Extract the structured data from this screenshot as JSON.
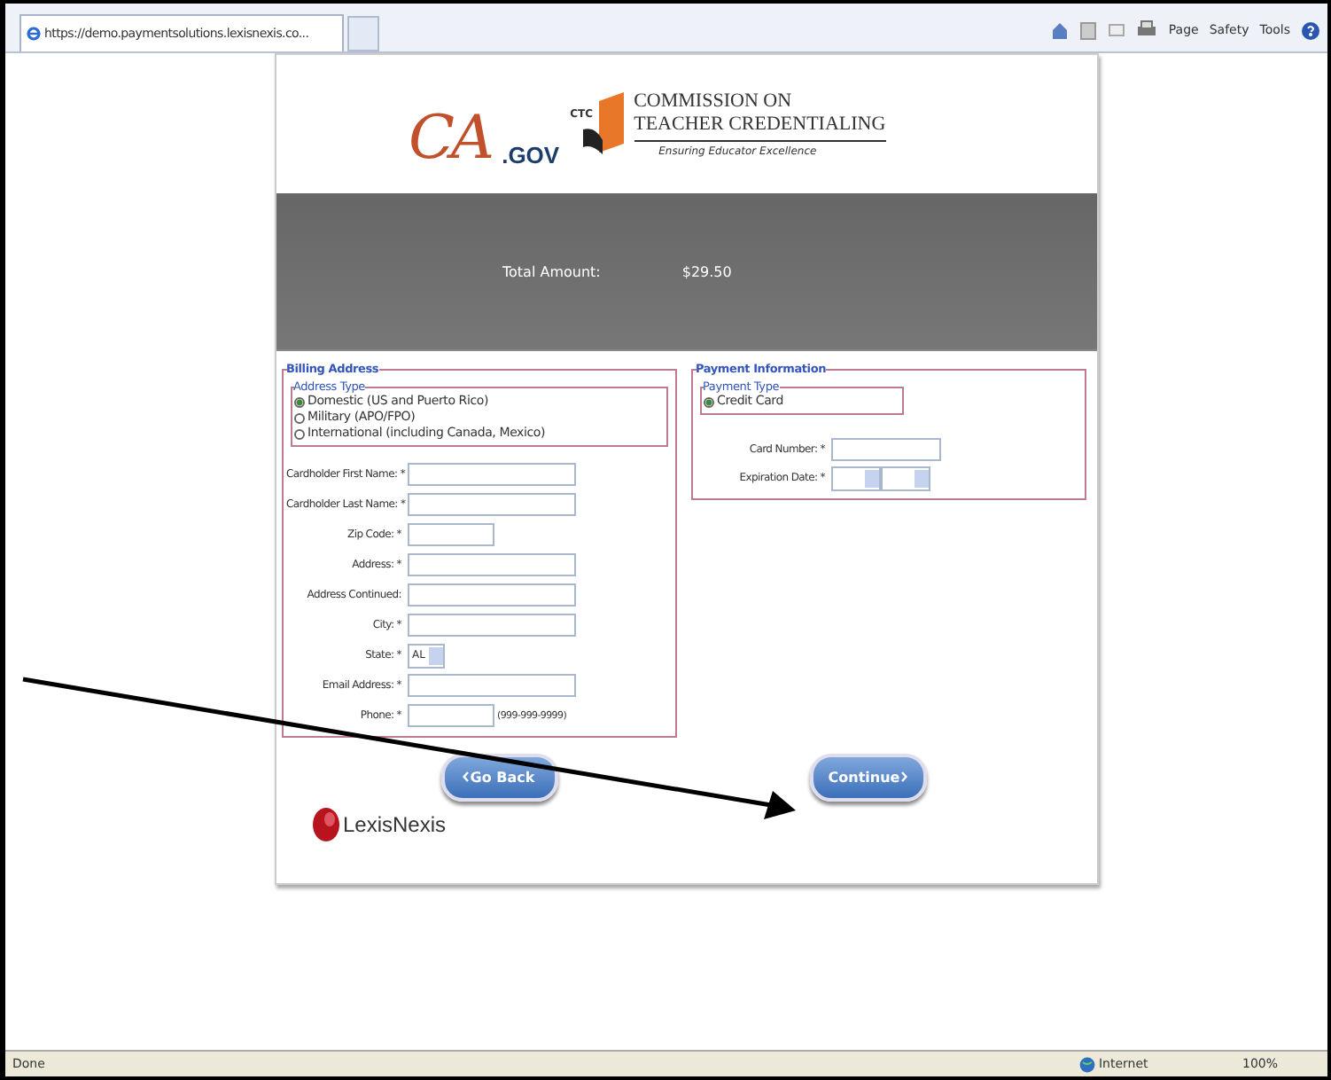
{
  "browser": {
    "tab_title": "https://demo.paymentsolutions.lexisnexis.co...",
    "toolbar": [
      "Page",
      "Safety",
      "Tools"
    ]
  },
  "header": {
    "ca_logo": "CA",
    "gov": ".GOV",
    "ctc": "CTC",
    "org_line1": "COMMISSION ON",
    "org_line2": "TEACHER CREDENTIALING",
    "tagline": "Ensuring Educator Excellence"
  },
  "total": {
    "label": "Total Amount:",
    "value": "$29.50"
  },
  "billing": {
    "legend": "Billing Address",
    "address_type": {
      "legend": "Address Type",
      "options": [
        {
          "label": "Domestic (US and Puerto Rico)",
          "selected": true
        },
        {
          "label": "Military (APO/FPO)",
          "selected": false
        },
        {
          "label": "International (including Canada, Mexico)",
          "selected": false
        }
      ]
    },
    "fields": [
      {
        "kind": "text",
        "label": "Cardholder First Name: *"
      },
      {
        "kind": "text",
        "label": "Cardholder Last Name: *"
      },
      {
        "kind": "short",
        "label": "Zip Code: *"
      },
      {
        "kind": "text",
        "label": "Address: *"
      },
      {
        "kind": "text",
        "label": "Address Continued:"
      },
      {
        "kind": "text",
        "label": "City: *"
      },
      {
        "kind": "select",
        "label": "State: *",
        "value": "AL"
      },
      {
        "kind": "text",
        "label": "Email Address: *"
      },
      {
        "kind": "short",
        "label": "Phone: *",
        "hint": "(999-999-9999)"
      }
    ]
  },
  "payment": {
    "legend": "Payment Information",
    "payment_type": {
      "legend": "Payment Type",
      "options": [
        {
          "label": "Credit Card",
          "selected": true
        }
      ]
    },
    "fields": [
      {
        "kind": "text",
        "label": "Card Number: *"
      },
      {
        "kind": "dates",
        "label": "Expiration Date: *"
      }
    ]
  },
  "buttons": {
    "back": "Go Back",
    "next": "Continue"
  },
  "footer_logo": "LexisNexis",
  "status_bar": {
    "text": "Done",
    "zone": "Internet",
    "zoom": "100%"
  }
}
